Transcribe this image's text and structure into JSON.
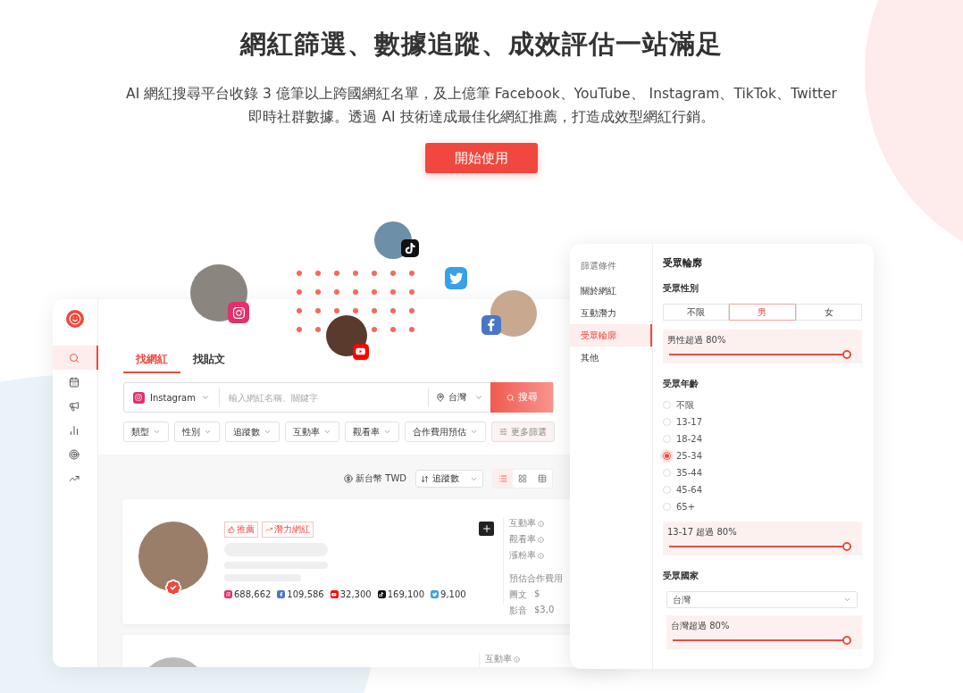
{
  "hero": {
    "title": "網紅篩選、數據追蹤、成效評估一站滿足",
    "description": [
      "AI 網紅搜尋平台收錄 3 億筆以上跨國網紅名單，及上億筆 Facebook、YouTube、 Instagram、TikTok、Twitter",
      "即時社群數據。透過 AI 技術達成最佳化網紅推薦，打造成效型網紅行銷。"
    ],
    "cta": "開始使用"
  },
  "floating_profiles": [
    {
      "kind": "instagram"
    },
    {
      "kind": "tiktok"
    },
    {
      "kind": "youtube"
    },
    {
      "kind": "facebook"
    },
    {
      "kind": "twitter"
    }
  ],
  "app": {
    "nav": [
      {
        "kind": "search",
        "selected": true
      },
      {
        "kind": "calendar",
        "selected": false
      },
      {
        "kind": "megaphone",
        "selected": false
      },
      {
        "kind": "chart",
        "selected": false
      },
      {
        "kind": "target",
        "selected": false
      },
      {
        "kind": "trend",
        "selected": false
      }
    ],
    "tabs": [
      {
        "label": "找網紅",
        "selected": true
      },
      {
        "label": "找貼文",
        "selected": false
      }
    ],
    "search": {
      "platform": "Instagram",
      "placeholder": "輸入網紅名稱、關鍵字",
      "location": "台灣",
      "button": "搜尋"
    },
    "filters": [
      "類型",
      "性別",
      "追蹤數",
      "互動率",
      "觀看率",
      "合作費用預估"
    ],
    "more_filters": "更多篩選",
    "toolbar": {
      "currency": "新台幣 TWD",
      "sort": "追蹤數",
      "view_modes": [
        {
          "kind": "list",
          "selected": true
        },
        {
          "kind": "grid",
          "selected": false
        },
        {
          "kind": "table",
          "selected": false
        }
      ]
    },
    "results": [
      {
        "tags": [
          {
            "kind": "like",
            "label": "推薦"
          },
          {
            "kind": "trend",
            "label": "潛力網紅"
          }
        ],
        "stats": [
          {
            "kind": "instagram",
            "value": "688,662"
          },
          {
            "kind": "facebook",
            "value": "109,586"
          },
          {
            "kind": "youtube",
            "value": "32,300"
          },
          {
            "kind": "tiktok",
            "value": "169,100"
          },
          {
            "kind": "twitter",
            "value": "9,100"
          }
        ],
        "metrics": [
          "互動率",
          "觀看率",
          "漲粉率"
        ],
        "pricing_title": "預估合作費用",
        "prices": [
          {
            "label": "圖文",
            "value": "$"
          },
          {
            "label": "影音",
            "value": "$3,0"
          }
        ]
      },
      {
        "metrics": [
          "互動率"
        ]
      }
    ]
  },
  "filter_panel": {
    "nav_heading": "篩選條件",
    "nav": [
      {
        "label": "關於網紅",
        "selected": false
      },
      {
        "label": "互動潛力",
        "selected": false
      },
      {
        "label": "受眾輪廓",
        "selected": true
      },
      {
        "label": "其他",
        "selected": false
      }
    ],
    "title": "受眾輪廓",
    "gender": {
      "title": "受眾性別",
      "options": [
        {
          "label": "不限",
          "selected": false
        },
        {
          "label": "男",
          "selected": true
        },
        {
          "label": "女",
          "selected": false
        }
      ],
      "slider": {
        "label": "男性超過 80%",
        "level": 0.95
      }
    },
    "age": {
      "title": "受眾年齡",
      "options": [
        {
          "label": "不限",
          "selected": false
        },
        {
          "label": "13-17",
          "selected": false
        },
        {
          "label": "18-24",
          "selected": false
        },
        {
          "label": "25-34",
          "selected": true
        },
        {
          "label": "35-44",
          "selected": false
        },
        {
          "label": "45-64",
          "selected": false
        },
        {
          "label": "65+",
          "selected": false
        }
      ],
      "slider": {
        "label": "13-17 超過 80%",
        "level": 0.95
      }
    },
    "country": {
      "title": "受眾國家",
      "value": "台灣",
      "slider": {
        "label": "台灣超過 80%",
        "level": 0.95
      }
    }
  }
}
